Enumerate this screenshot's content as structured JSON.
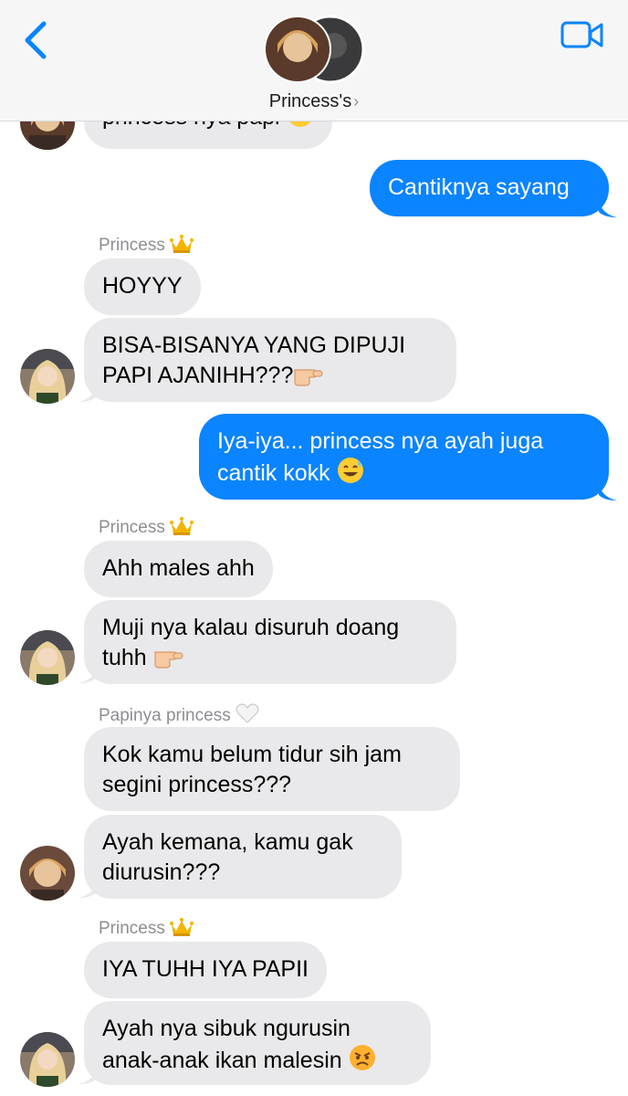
{
  "header": {
    "title": "Princess's",
    "chevron": "›",
    "back_icon": "chevron-left-icon",
    "video_icon": "video-camera-icon",
    "accent": "#0a84ff"
  },
  "messages": [
    {
      "id": "m0",
      "direction": "in",
      "text": "princess nya papi",
      "emoji": "relieved"
    },
    {
      "id": "m1",
      "direction": "out",
      "text": "Cantiknya sayang"
    },
    {
      "id": "m2",
      "direction": "in",
      "sender": "Princess",
      "sender_emoji": "crown",
      "text": "HOYYY"
    },
    {
      "id": "m3",
      "direction": "in",
      "lines": [
        "BISA-BISANYA YANG DIPUJI",
        "PAPI AJANIHH???"
      ],
      "emoji": "pointing"
    },
    {
      "id": "m4",
      "direction": "out",
      "lines": [
        "Iya-iya... princess nya ayah juga",
        "cantik kokk"
      ],
      "emoji": "sweat-smile"
    },
    {
      "id": "m5",
      "direction": "in",
      "sender": "Princess",
      "sender_emoji": "crown",
      "text": "Ahh males ahh"
    },
    {
      "id": "m6",
      "direction": "in",
      "lines": [
        "Muji nya kalau disuruh doang",
        "tuhh"
      ],
      "emoji": "pointing"
    },
    {
      "id": "m7",
      "direction": "in",
      "sender": "Papinya princess",
      "sender_emoji": "white-heart",
      "lines": [
        "Kok kamu belum tidur sih jam",
        "segini princess???"
      ]
    },
    {
      "id": "m8",
      "direction": "in",
      "lines": [
        "Ayah kemana, kamu gak",
        "diurusin???"
      ]
    },
    {
      "id": "m9",
      "direction": "in",
      "sender": "Princess",
      "sender_emoji": "crown",
      "text": "IYA TUHH IYA PAPII"
    },
    {
      "id": "m10",
      "direction": "in",
      "lines": [
        "Ayah nya sibuk ngurusin",
        "anak-anak ikan malesin"
      ],
      "emoji": "angry"
    }
  ],
  "text": {
    "m0": "princess nya papi",
    "m1": "Cantiknya sayang",
    "m2_sender": "Princess",
    "m2": "HOYYY",
    "m3_l1": "BISA-BISANYA YANG DIPUJI",
    "m3_l2": "PAPI AJANIHH???",
    "m4_l1": "Iya-iya... princess nya ayah juga",
    "m4_l2": "cantik kokk",
    "m5_sender": "Princess",
    "m5": "Ahh males ahh",
    "m6_l1": "Muji nya kalau disuruh doang",
    "m6_l2": "tuhh",
    "m7_sender": "Papinya princess",
    "m7_l1": "Kok kamu belum tidur sih jam",
    "m7_l2": "segini princess???",
    "m8_l1": "Ayah kemana, kamu gak",
    "m8_l2": "diurusin???",
    "m9_sender": "Princess",
    "m9": "IYA TUHH IYA PAPII",
    "m10_l1": "Ayah nya sibuk ngurusin",
    "m10_l2": "anak-anak ikan malesin"
  },
  "colors": {
    "incoming_bubble": "#e9e9eb",
    "outgoing_bubble": "#0a84ff",
    "sender_label": "#8e8e93",
    "header_bg": "#f6f6f7"
  }
}
